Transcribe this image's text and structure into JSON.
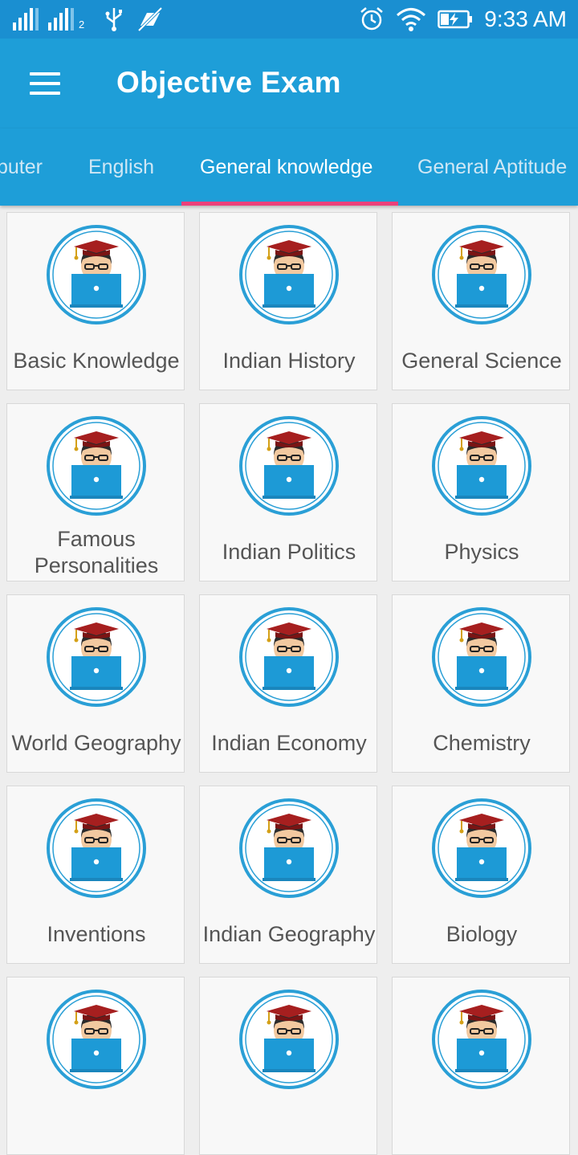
{
  "status_bar": {
    "sim2_number": "2",
    "time": "9:33 AM"
  },
  "app_bar": {
    "title": "Objective Exam"
  },
  "tabs": [
    {
      "label": "puter"
    },
    {
      "label": "English"
    },
    {
      "label": "General knowledge"
    },
    {
      "label": "General Aptitude"
    }
  ],
  "colors": {
    "status_bar": "#1a8fd1",
    "app_bar": "#1e9ed8",
    "tab_indicator": "#ec407a",
    "card_bg": "#f8f8f8",
    "logo_ring": "#2a9fd6"
  },
  "categories": [
    {
      "label": "Basic Knowledge"
    },
    {
      "label": "Indian History"
    },
    {
      "label": "General Science"
    },
    {
      "label": "Famous Personalities"
    },
    {
      "label": "Indian Politics"
    },
    {
      "label": "Physics"
    },
    {
      "label": "World Geography"
    },
    {
      "label": "Indian Economy"
    },
    {
      "label": "Chemistry"
    },
    {
      "label": "Inventions"
    },
    {
      "label": "Indian Geography"
    },
    {
      "label": "Biology"
    }
  ]
}
